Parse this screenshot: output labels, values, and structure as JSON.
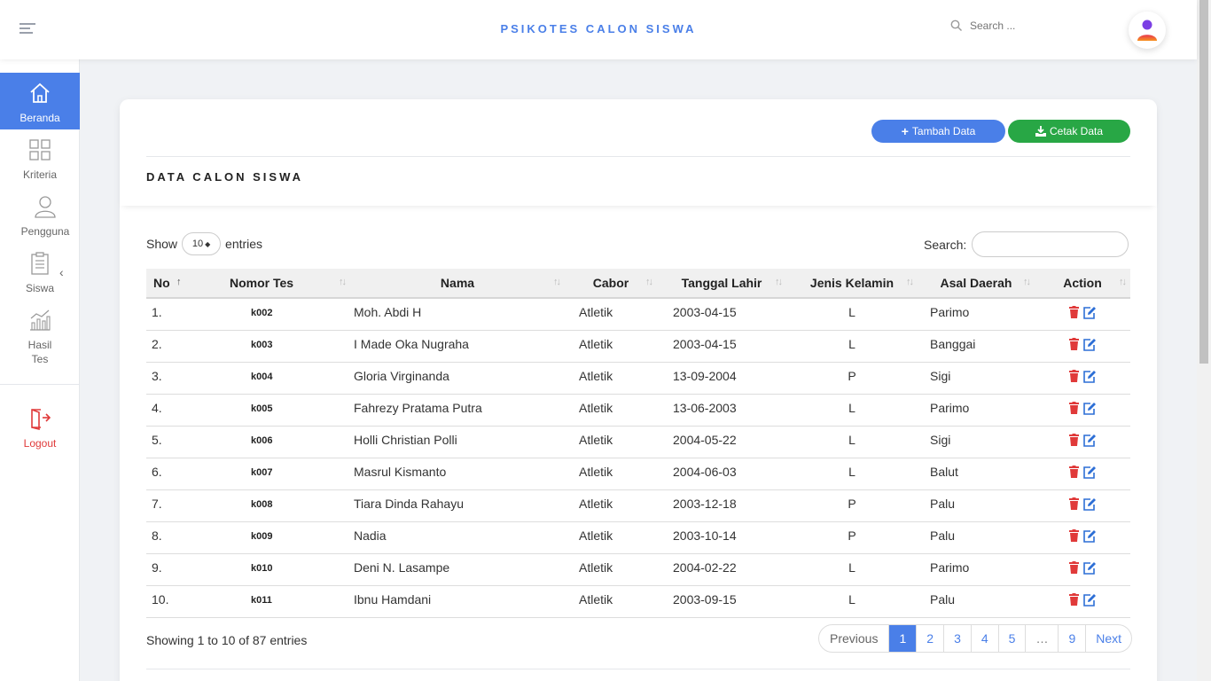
{
  "header": {
    "title": "PSIKOTES CALON SISWA",
    "search_placeholder": "Search ..."
  },
  "sidebar": {
    "items": [
      {
        "label": "Beranda",
        "icon": "home-icon"
      },
      {
        "label": "Kriteria",
        "icon": "grid-icon"
      },
      {
        "label": "Pengguna",
        "icon": "user-icon"
      },
      {
        "label": "Siswa",
        "icon": "clipboard-icon"
      },
      {
        "label": "Hasil Tes",
        "icon": "chart-icon"
      },
      {
        "label": "Logout",
        "icon": "logout-icon"
      }
    ]
  },
  "card": {
    "add_label": "Tambah Data",
    "print_label": "Cetak Data",
    "title": "DATA CALON SISWA"
  },
  "table_controls": {
    "show_label": "Show",
    "entries_value": "10",
    "entries_label": "entries",
    "search_label": "Search:"
  },
  "table": {
    "columns": [
      "No",
      "Nomor Tes",
      "Nama",
      "Cabor",
      "Tanggal Lahir",
      "Jenis Kelamin",
      "Asal Daerah",
      "Action"
    ],
    "rows": [
      [
        "1.",
        "k002",
        "Moh. Abdi H",
        "Atletik",
        "2003-04-15",
        "L",
        "Parimo"
      ],
      [
        "2.",
        "k003",
        "I Made Oka Nugraha",
        "Atletik",
        "2003-04-15",
        "L",
        "Banggai"
      ],
      [
        "3.",
        "k004",
        "Gloria Virginanda",
        "Atletik",
        "13-09-2004",
        "P",
        "Sigi"
      ],
      [
        "4.",
        "k005",
        "Fahrezy Pratama Putra",
        "Atletik",
        "13-06-2003",
        "L",
        "Parimo"
      ],
      [
        "5.",
        "k006",
        "Holli Christian Polli",
        "Atletik",
        "2004-05-22",
        "L",
        "Sigi"
      ],
      [
        "6.",
        "k007",
        "Masrul Kismanto",
        "Atletik",
        "2004-06-03",
        "L",
        "Balut"
      ],
      [
        "7.",
        "k008",
        "Tiara Dinda Rahayu",
        "Atletik",
        "2003-12-18",
        "P",
        "Palu"
      ],
      [
        "8.",
        "k009",
        "Nadia",
        "Atletik",
        "2003-10-14",
        "P",
        "Palu"
      ],
      [
        "9.",
        "k010",
        "Deni N. Lasampe",
        "Atletik",
        "2004-02-22",
        "L",
        "Parimo"
      ],
      [
        "10.",
        "k011",
        "Ibnu Hamdani",
        "Atletik",
        "2003-09-15",
        "L",
        "Palu"
      ]
    ]
  },
  "footer": {
    "info": "Showing 1 to 10 of 87 entries",
    "pagination": [
      "Previous",
      "1",
      "2",
      "3",
      "4",
      "5",
      "…",
      "9",
      "Next"
    ],
    "active_page": "1"
  },
  "colors": {
    "accent": "#4a7fe8",
    "success": "#28a745",
    "danger": "#e03a3a"
  }
}
